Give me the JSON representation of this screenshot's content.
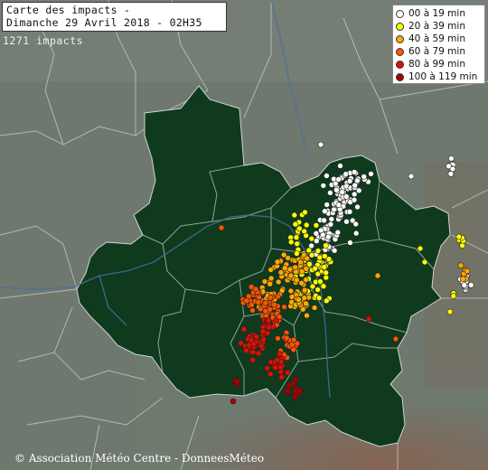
{
  "title": {
    "line1": "Carte des impacts -",
    "line2": "Dimanche 29 Avril 2018 - 02H35"
  },
  "impact_count": "1271 impacts",
  "legend": [
    {
      "label": "00 à 19 min",
      "color": "#ffffff"
    },
    {
      "label": "20 à 39 min",
      "color": "#ffff00"
    },
    {
      "label": "40 à 59 min",
      "color": "#ffaa00"
    },
    {
      "label": "60 à 79 min",
      "color": "#ff5500"
    },
    {
      "label": "80 à 99 min",
      "color": "#dd1100"
    },
    {
      "label": "100 à 119 min",
      "color": "#aa0000"
    }
  ],
  "credit": "© Association Météo Centre - DonneesMéteo",
  "colors": {
    "background_terrain": "#6f7a6f",
    "region_fill": "#0f3a1e",
    "borders": "#bfc7bf",
    "river": "#4a6fa0"
  }
}
